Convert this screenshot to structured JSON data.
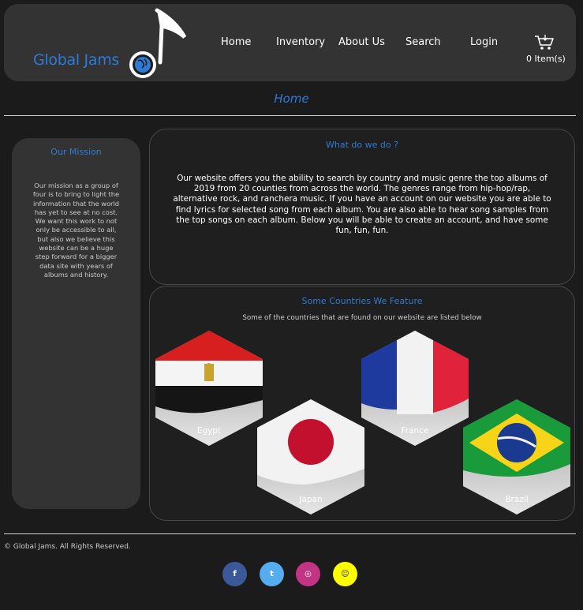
{
  "header": {
    "logo_text": "Global Jams",
    "nav": [
      {
        "label": "Home"
      },
      {
        "label": "Inventory"
      },
      {
        "label": "About Us"
      },
      {
        "label": "Search"
      },
      {
        "label": "Login"
      }
    ],
    "cart": {
      "count_label": "0 Item(s)",
      "icon": "cart-icon"
    }
  },
  "page_title": "Home",
  "mission": {
    "title": "Our Mission",
    "text": "Our mission as a group of four is to bring to light the information that the world has yet to see at no cost. We want this work to not only be accessible to all, but also we believe this website can be a huge step forward for a bigger data site with years of albums and history."
  },
  "what_we_do": {
    "title": "What do we do ?",
    "text": "Our website offers you the ability to search by country and music genre the top albums of 2019 from 20 counties from across the world. The genres range from hip-hop/rap, alternative rock, and ranchera music. If you have an account on our website you are able to find lyrics for selected song from each album. You are also able to hear song samples from the top songs on each album. Below you will be able to create an account, and have some fun, fun, fun."
  },
  "countries": {
    "title": "Some Countries We Feature",
    "subtitle": "Some of the countries that are found on our website are listed below",
    "items": [
      {
        "name": "Egypt"
      },
      {
        "name": "Japan"
      },
      {
        "name": "France"
      },
      {
        "name": "Brazil"
      }
    ]
  },
  "footer": {
    "copyright": "© Global Jams. All Rights Reserved.",
    "social": [
      {
        "icon": "facebook-icon",
        "glyph": "f",
        "color": "#3b5998"
      },
      {
        "icon": "twitter-icon",
        "glyph": "t",
        "color": "#55acee"
      },
      {
        "icon": "instagram-icon",
        "glyph": "◎",
        "color": "#c13584"
      },
      {
        "icon": "snapchat-icon",
        "glyph": "☺",
        "color": "#fffc00"
      }
    ]
  },
  "colors": {
    "accent": "#2e7bd6",
    "background": "#1b1b1b",
    "panel": "#333333"
  }
}
